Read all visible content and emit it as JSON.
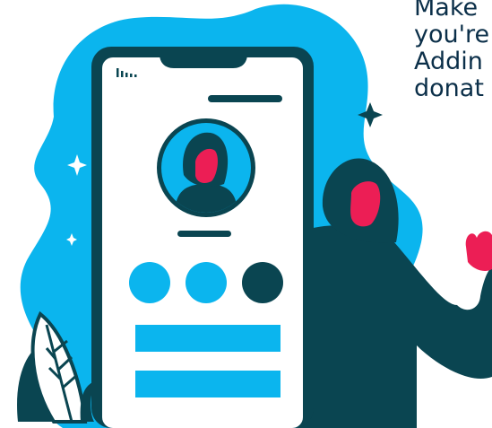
{
  "caption": {
    "lines": [
      "Make",
      "you're",
      "Addin",
      "donat"
    ]
  },
  "colors": {
    "blob": "#0bb5ee",
    "accent": "#0bb5ee",
    "dark": "#0a4551",
    "face": "#ec1e55",
    "white": "#ffffff",
    "text": "#0b2f49"
  },
  "phone": {
    "status_icon": "signal-bars-icon",
    "profile_circles": 3,
    "action_buttons": 2
  }
}
